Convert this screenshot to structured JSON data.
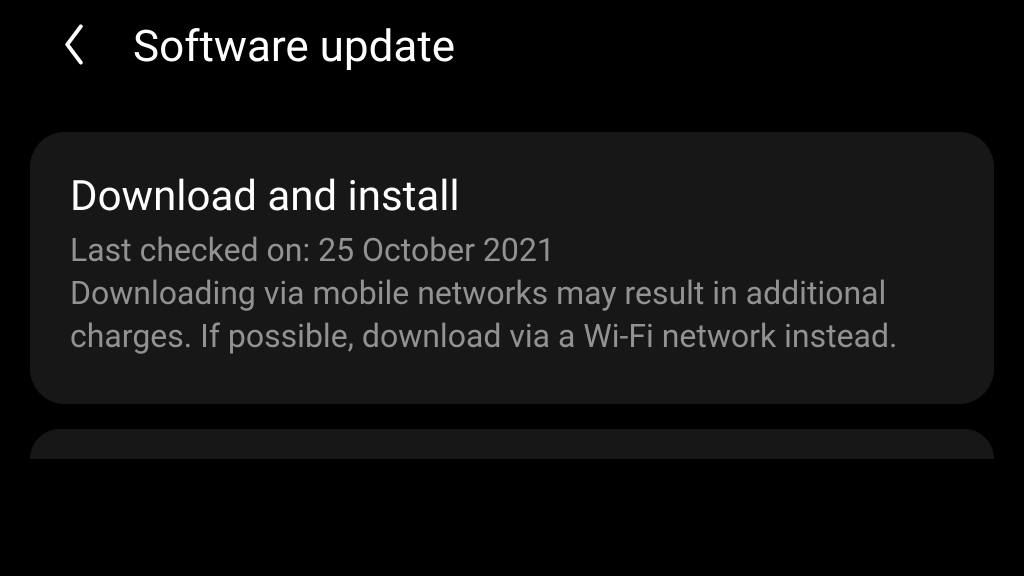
{
  "header": {
    "title": "Software update"
  },
  "download_card": {
    "title": "Download and install",
    "last_checked_label": "Last checked on: 25 October 2021",
    "description": "Downloading via mobile networks may result in additional charges. If possible, download via a Wi-Fi network instead."
  }
}
